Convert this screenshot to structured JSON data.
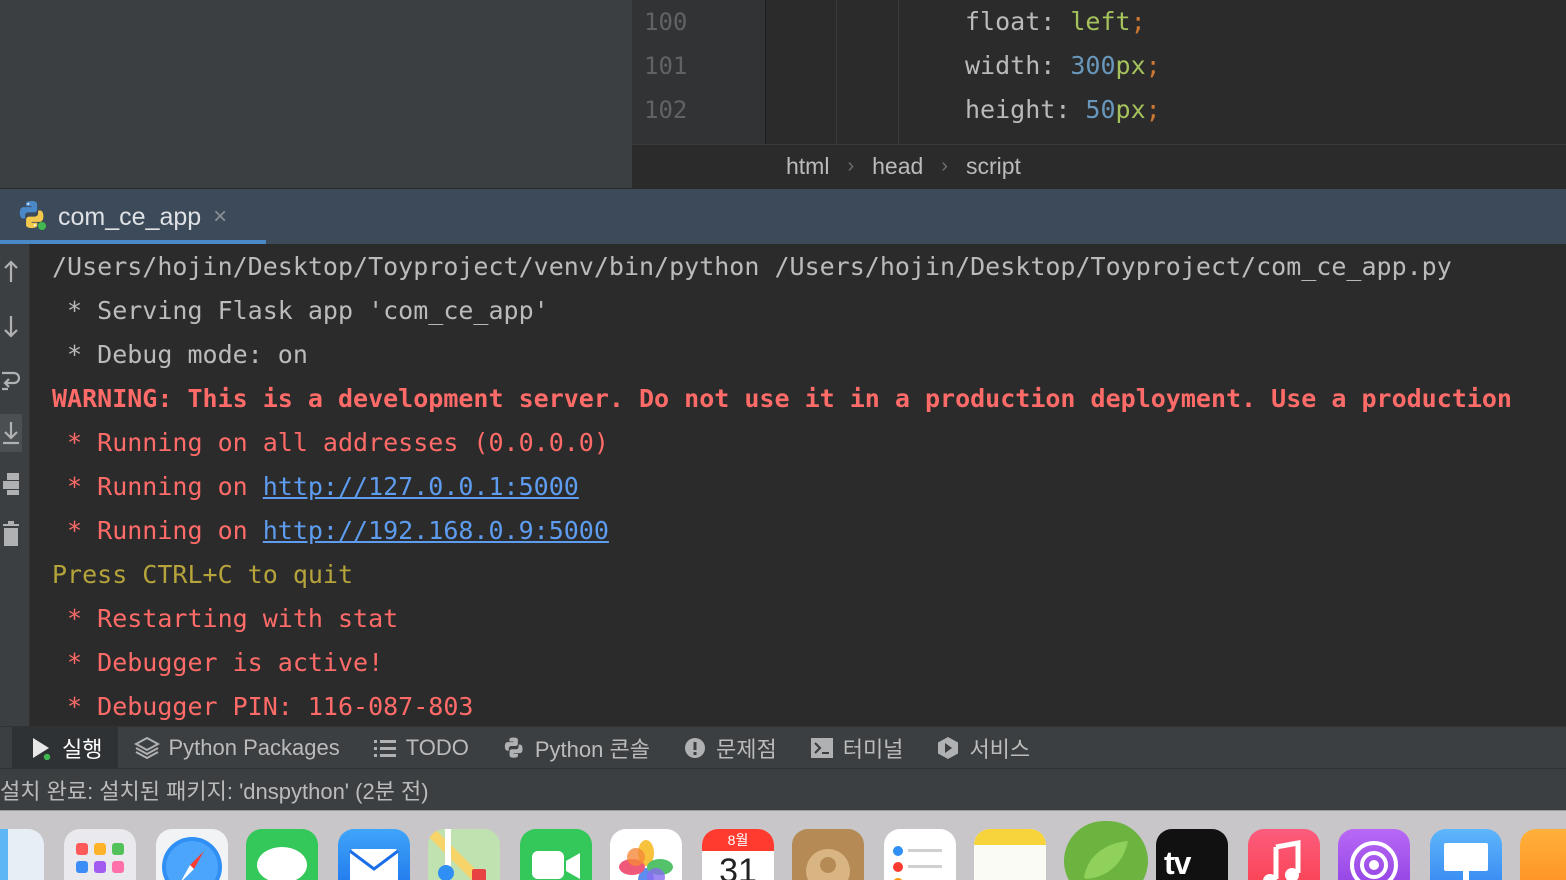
{
  "editor": {
    "lines": [
      {
        "num": "100",
        "prop": "float",
        "value": "left",
        "unit": ""
      },
      {
        "num": "101",
        "prop": "width",
        "value": "300",
        "unit": "px"
      },
      {
        "num": "102",
        "prop": "height",
        "value": "50",
        "unit": "px"
      }
    ],
    "breadcrumb": [
      "html",
      "head",
      "script"
    ]
  },
  "run": {
    "tab_label": "com_ce_app",
    "close_glyph": "×",
    "console": {
      "cmd": "/Users/hojin/Desktop/Toyproject/venv/bin/python /Users/hojin/Desktop/Toyproject/com_ce_app.py",
      "serving": " * Serving Flask app 'com_ce_app'",
      "debug_mode": " * Debug mode: on",
      "warning": "WARNING: This is a development server. Do not use it in a production deployment. Use a production",
      "running_all": " * Running on all addresses (0.0.0.0)",
      "running_prefix": " * Running on ",
      "link_local": "http://127.0.0.1:5000",
      "link_lan": "http://192.168.0.9:5000",
      "quit": "Press CTRL+C to quit",
      "restarting": " * Restarting with stat",
      "debugger_active": " * Debugger is active!",
      "debugger_pin": " * Debugger PIN: 116-087-803"
    }
  },
  "tool_tabs": [
    {
      "label": "실행",
      "icon": "play-icon",
      "active": true
    },
    {
      "label": "Python Packages",
      "icon": "layers-icon",
      "active": false
    },
    {
      "label": "TODO",
      "icon": "list-icon",
      "active": false
    },
    {
      "label": "Python 콘솔",
      "icon": "python-icon",
      "active": false
    },
    {
      "label": "문제점",
      "icon": "alert-icon",
      "active": false
    },
    {
      "label": "터미널",
      "icon": "terminal-icon",
      "active": false
    },
    {
      "label": "서비스",
      "icon": "services-icon",
      "active": false
    }
  ],
  "status": {
    "text": "설치 완료: 설치된 패키지: 'dnspython' (2분 전)"
  },
  "dock": {
    "calendar_month": "8월",
    "calendar_day": "31",
    "tv_label": "tv",
    "apps": [
      "finder-icon",
      "launchpad-icon",
      "safari-icon",
      "messages-icon",
      "mail-icon",
      "maps-icon",
      "facetime-icon",
      "photos-icon",
      "calendar-icon",
      "contacts-icon",
      "reminders-icon",
      "notes-icon",
      "pycharm-spring-icon",
      "apple-tv-icon",
      "music-icon",
      "podcasts-icon",
      "keynote-icon",
      "pages-icon"
    ]
  },
  "colors": {
    "accent": "#4a88c7",
    "error": "#ff6b68",
    "link": "#5e9cf0",
    "hint": "#b5a33b"
  }
}
